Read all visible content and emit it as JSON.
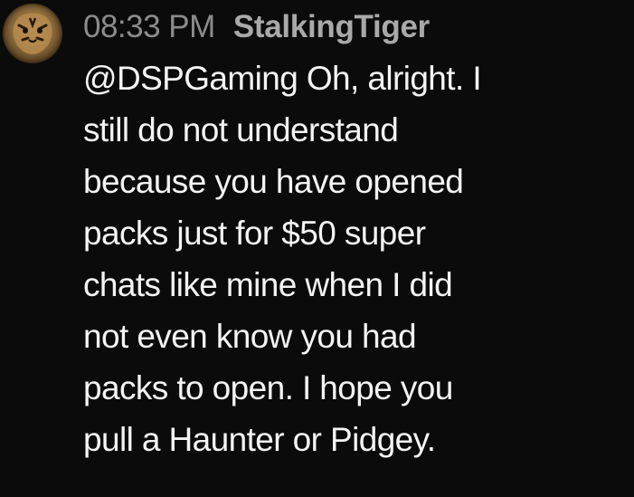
{
  "message": {
    "avatar_icon": "tiger-avatar-icon",
    "timestamp": "08:33 PM",
    "author": "StalkingTiger",
    "lines": [
      "@DSPGaming Oh, alright. I",
      "still do not understand",
      "because you have opened",
      "packs just for $50 super",
      "chats like mine when I did",
      "not even know you had",
      "packs to open. I hope you",
      "pull a Haunter or Pidgey."
    ]
  },
  "colors": {
    "background": "#0b0b0b",
    "timestamp": "#8c8c8c",
    "author": "#a9a9a9",
    "text": "#f4f4f4"
  }
}
